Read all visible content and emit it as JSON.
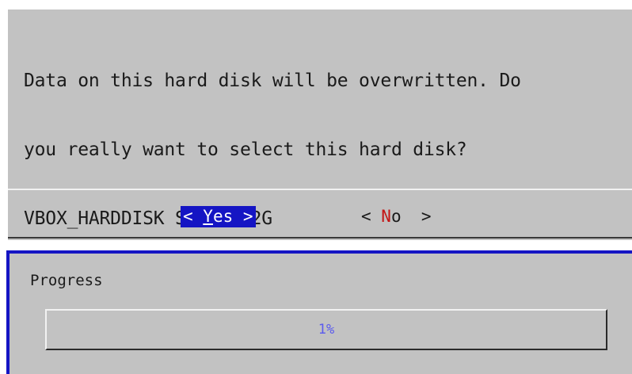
{
  "dialog": {
    "message_lines": [
      "Data on this hard disk will be overwritten. Do",
      "you really want to select this hard disk?",
      "VBOX_HARDDISK Size: 32G"
    ],
    "yes_button": {
      "open": "< ",
      "hotkey": "Y",
      "rest": "es",
      "close": " >"
    },
    "no_button": {
      "open": "< ",
      "hotkey": "N",
      "rest": "o",
      "close": "  >"
    }
  },
  "progress": {
    "title": "Progress",
    "percent_label": "1%",
    "value": 0.01
  },
  "colors": {
    "dialog_bg": "#c2c2c2",
    "selected_button_bg": "#1515c4",
    "hotkey_red": "#c41515",
    "progress_text": "#5a5aee"
  }
}
